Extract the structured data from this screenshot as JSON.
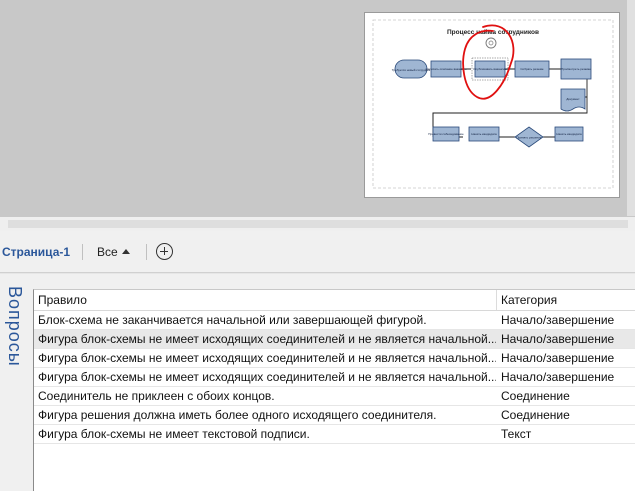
{
  "canvas": {
    "diagram": {
      "title": "Процесс найма сотрудников",
      "shapes": {
        "start": "Требуется новый сотрудник",
        "write_job": "Написать описание вакансии",
        "post_job": "Опубликовать вакансию",
        "collect": "Собрать резюме",
        "review": "Просмотреть резюме",
        "interview": "Провести собеседование",
        "decision": "Принять решение",
        "hire": "Нанять кандидата",
        "document": "Документ"
      },
      "annotation_color": "#e01010"
    }
  },
  "page_tabs": {
    "active_page": "Страница-1",
    "all_pages": "Все"
  },
  "issues_pane": {
    "title": "Вопросы",
    "columns": [
      "Правило",
      "Категория"
    ],
    "rows": [
      {
        "rule": "Блок-схема не заканчивается начальной или завершающей фигурой.",
        "category": "Начало/завершение"
      },
      {
        "rule": "Фигура блок-схемы не имеет исходящих соединителей и не является начальной...",
        "category": "Начало/завершение"
      },
      {
        "rule": "Фигура блок-схемы не имеет исходящих соединителей и не является начальной...",
        "category": "Начало/завершение"
      },
      {
        "rule": "Фигура блок-схемы не имеет исходящих соединителей и не является начальной...",
        "category": "Начало/завершение"
      },
      {
        "rule": "Соединитель не приклеен с обоих концов.",
        "category": "Соединение"
      },
      {
        "rule": "Фигура решения должна иметь более одного исходящего соединителя.",
        "category": "Соединение"
      },
      {
        "rule": "Фигура блок-схемы не имеет текстовой подписи.",
        "category": "Текст"
      }
    ],
    "selected_row": 1
  }
}
